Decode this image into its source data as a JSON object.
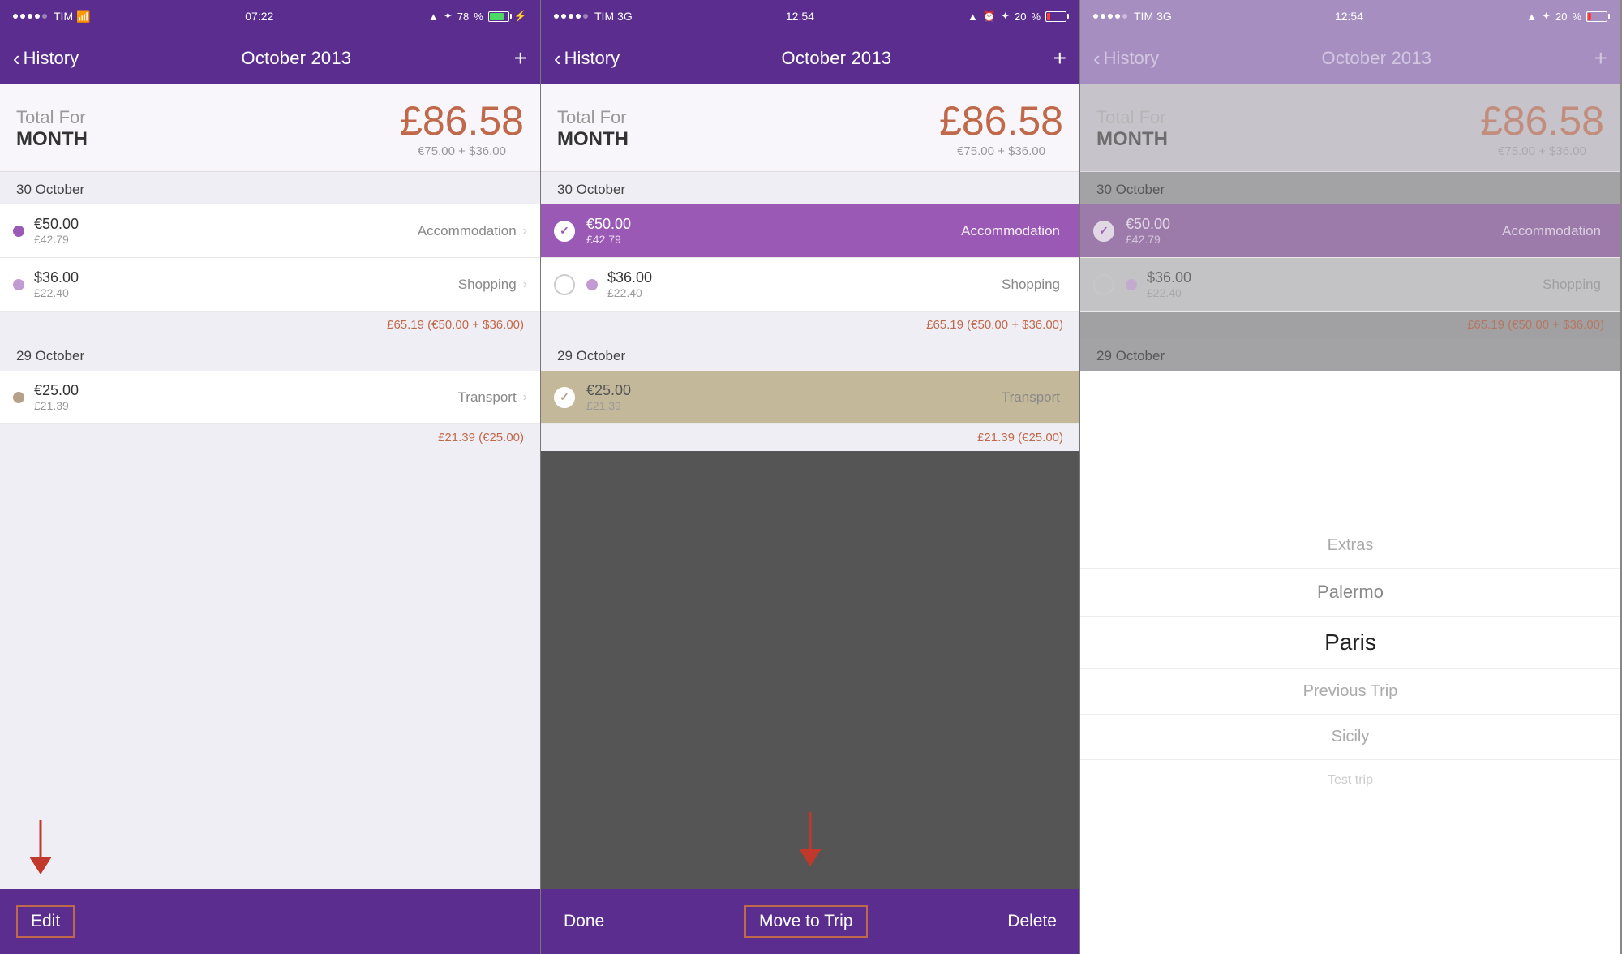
{
  "panels": [
    {
      "id": "panel1",
      "status": {
        "carrier": "TIM",
        "signal_dots": [
          true,
          true,
          true,
          true,
          false
        ],
        "wifi": true,
        "time": "07:22",
        "location": true,
        "bluetooth": true,
        "battery_pct": 78,
        "battery_color": "green",
        "charging": true
      },
      "nav": {
        "back_label": "History",
        "title": "October 2013",
        "plus": "+"
      },
      "total": {
        "label_line1": "Total For",
        "label_line2": "MONTH",
        "amount": "£86.58",
        "sub": "€75.00 + $36.00"
      },
      "sections": [
        {
          "date": "30 October",
          "items": [
            {
              "dot_color": "purple",
              "main": "€50.00",
              "secondary": "£42.79",
              "category": "Accommodation",
              "has_chevron": true
            },
            {
              "dot_color": "light-purple",
              "main": "$36.00",
              "secondary": "£22.40",
              "category": "Shopping",
              "has_chevron": true
            }
          ],
          "day_total": "£65.19 (€50.00 + $36.00)"
        },
        {
          "date": "29 October",
          "items": [
            {
              "dot_color": "tan",
              "main": "€25.00",
              "secondary": "£21.39",
              "category": "Transport",
              "has_chevron": true
            }
          ],
          "day_total": "£21.39 (€25.00)"
        }
      ],
      "bottom": {
        "mode": "edit",
        "edit_label": "Edit"
      }
    },
    {
      "id": "panel2",
      "status": {
        "carrier": "TIM",
        "network": "3G",
        "signal_dots": [
          true,
          true,
          true,
          true,
          false
        ],
        "time": "12:54",
        "location": true,
        "alarm": true,
        "bluetooth": true,
        "battery_pct": 20,
        "battery_color": "red"
      },
      "nav": {
        "back_label": "History",
        "title": "October 2013",
        "plus": "+"
      },
      "total": {
        "label_line1": "Total For",
        "label_line2": "MONTH",
        "amount": "£86.58",
        "sub": "€75.00 + $36.00"
      },
      "sections": [
        {
          "date": "30 October",
          "items": [
            {
              "selected": true,
              "highlight": "purple",
              "main": "€50.00",
              "secondary": "£42.79",
              "category": "Accommodation"
            },
            {
              "select_mode": true,
              "dot_color": "light-purple",
              "main": "$36.00",
              "secondary": "£22.40",
              "category": "Shopping"
            }
          ],
          "day_total": "£65.19 (€50.00 + $36.00)"
        },
        {
          "date": "29 October",
          "items": [
            {
              "selected": true,
              "highlight": "tan",
              "main": "€25.00",
              "secondary": "£21.39",
              "category": "Transport"
            }
          ],
          "day_total": "£21.39 (€25.00)"
        }
      ],
      "bottom": {
        "mode": "select",
        "done_label": "Done",
        "move_label": "Move to Trip",
        "delete_label": "Delete"
      }
    },
    {
      "id": "panel3",
      "dimmed": true,
      "status": {
        "carrier": "TIM",
        "network": "3G",
        "signal_dots": [
          true,
          true,
          true,
          true,
          false
        ],
        "time": "12:54",
        "location": true,
        "bluetooth": true,
        "battery_pct": 20,
        "battery_color": "red"
      },
      "nav": {
        "back_label": "History",
        "title": "October 2013",
        "plus": "+"
      },
      "total": {
        "label_line1": "Total For",
        "label_line2": "MONTH",
        "amount": "£86.58",
        "sub": "€75.00 + $36.00"
      },
      "sections": [
        {
          "date": "30 October",
          "items": [
            {
              "selected": true,
              "highlight": "purple",
              "main": "€50.00",
              "secondary": "£42.79",
              "category": "Accommodation"
            },
            {
              "select_mode": true,
              "dot_color": "light-purple",
              "main": "$36.00",
              "secondary": "£22.40",
              "category": "Shopping"
            }
          ],
          "day_total": "£65.19 (€50.00 + $36.00)"
        }
      ],
      "trip_picker": {
        "options": [
          {
            "label": "Extras",
            "selected": false
          },
          {
            "label": "Palermo",
            "selected": false
          },
          {
            "label": "Paris",
            "selected": true
          },
          {
            "label": "Previous Trip",
            "selected": false
          },
          {
            "label": "Sicily",
            "selected": false
          },
          {
            "label": "Test trip",
            "selected": false,
            "dimmed": true
          }
        ]
      }
    }
  ],
  "arrow1": "↓",
  "arrow2": "↓"
}
